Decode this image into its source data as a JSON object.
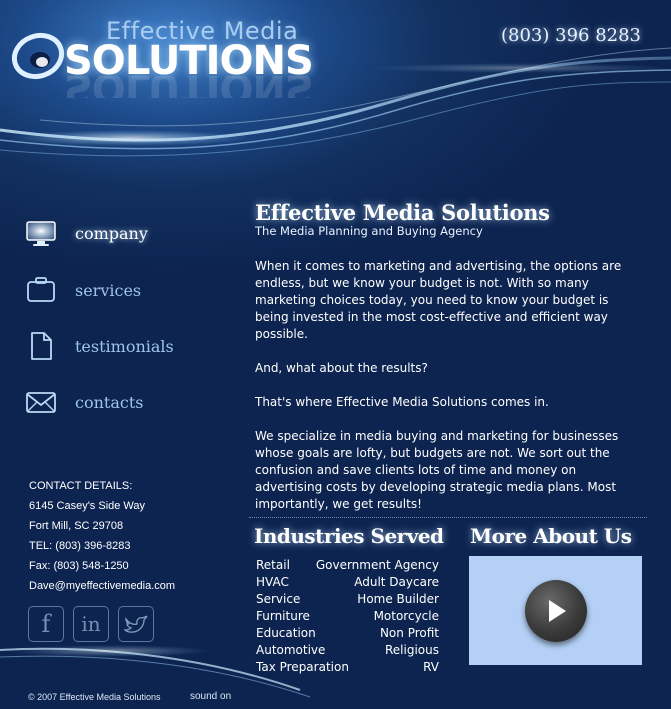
{
  "header": {
    "logo_top": "Effective Media",
    "logo_main": "SOLUTIONS",
    "phone": "(803) 396 8283"
  },
  "nav": {
    "items": [
      {
        "label": "company",
        "icon": "monitor-icon",
        "active": true
      },
      {
        "label": "services",
        "icon": "briefcase-icon",
        "active": false
      },
      {
        "label": "testimonials",
        "icon": "document-icon",
        "active": false
      },
      {
        "label": "contacts",
        "icon": "envelope-icon",
        "active": false
      }
    ]
  },
  "contact": {
    "heading": "CONTACT DETAILS:",
    "address1": "6145 Casey's Side Way",
    "address2": "Fort Mill, SC 29708",
    "tel": "TEL: (803) 396-8283",
    "fax": "Fax: (803) 548-1250",
    "email": "Dave@myeffectivemedia.com"
  },
  "social": {
    "items": [
      {
        "glyph": "f",
        "icon": "facebook-icon"
      },
      {
        "glyph": "in",
        "icon": "linkedin-icon"
      },
      {
        "glyph": "",
        "icon": "twitter-bird-icon"
      }
    ]
  },
  "main": {
    "title": "Effective Media Solutions",
    "subtitle": "The Media Planning and Buying Agency",
    "paragraphs": [
      "When it comes to marketing and advertising, the options are endless, but we know your budget is not. With so many marketing choices today, you need to know your budget is being invested in the most cost-effective and efficient way possible.",
      "And, what about the results?",
      "That's where Effective Media Solutions comes in.",
      "We specialize in media buying and marketing for businesses whose goals are lofty, but budgets are not. We sort out the confusion and save clients lots of time and money on advertising costs by developing strategic media plans. Most importantly, we get results!"
    ]
  },
  "industries": {
    "title": "Industries Served",
    "left": [
      "Retail",
      "HVAC",
      "Service",
      "Furniture",
      "Education",
      "Automotive",
      "Tax Preparation"
    ],
    "right": [
      "Government Agency",
      "Adult Daycare",
      "Home Builder",
      "Motorcycle",
      "Non Profit",
      "Religious",
      "RV"
    ]
  },
  "more": {
    "title": "More About Us"
  },
  "footer": {
    "copyright": "© 2007 Effective Media Solutions",
    "sound": "sound on"
  },
  "colors": {
    "background": "#12305f",
    "accent_glow": "#a8dcff",
    "video_bg": "#b4d0f6"
  }
}
